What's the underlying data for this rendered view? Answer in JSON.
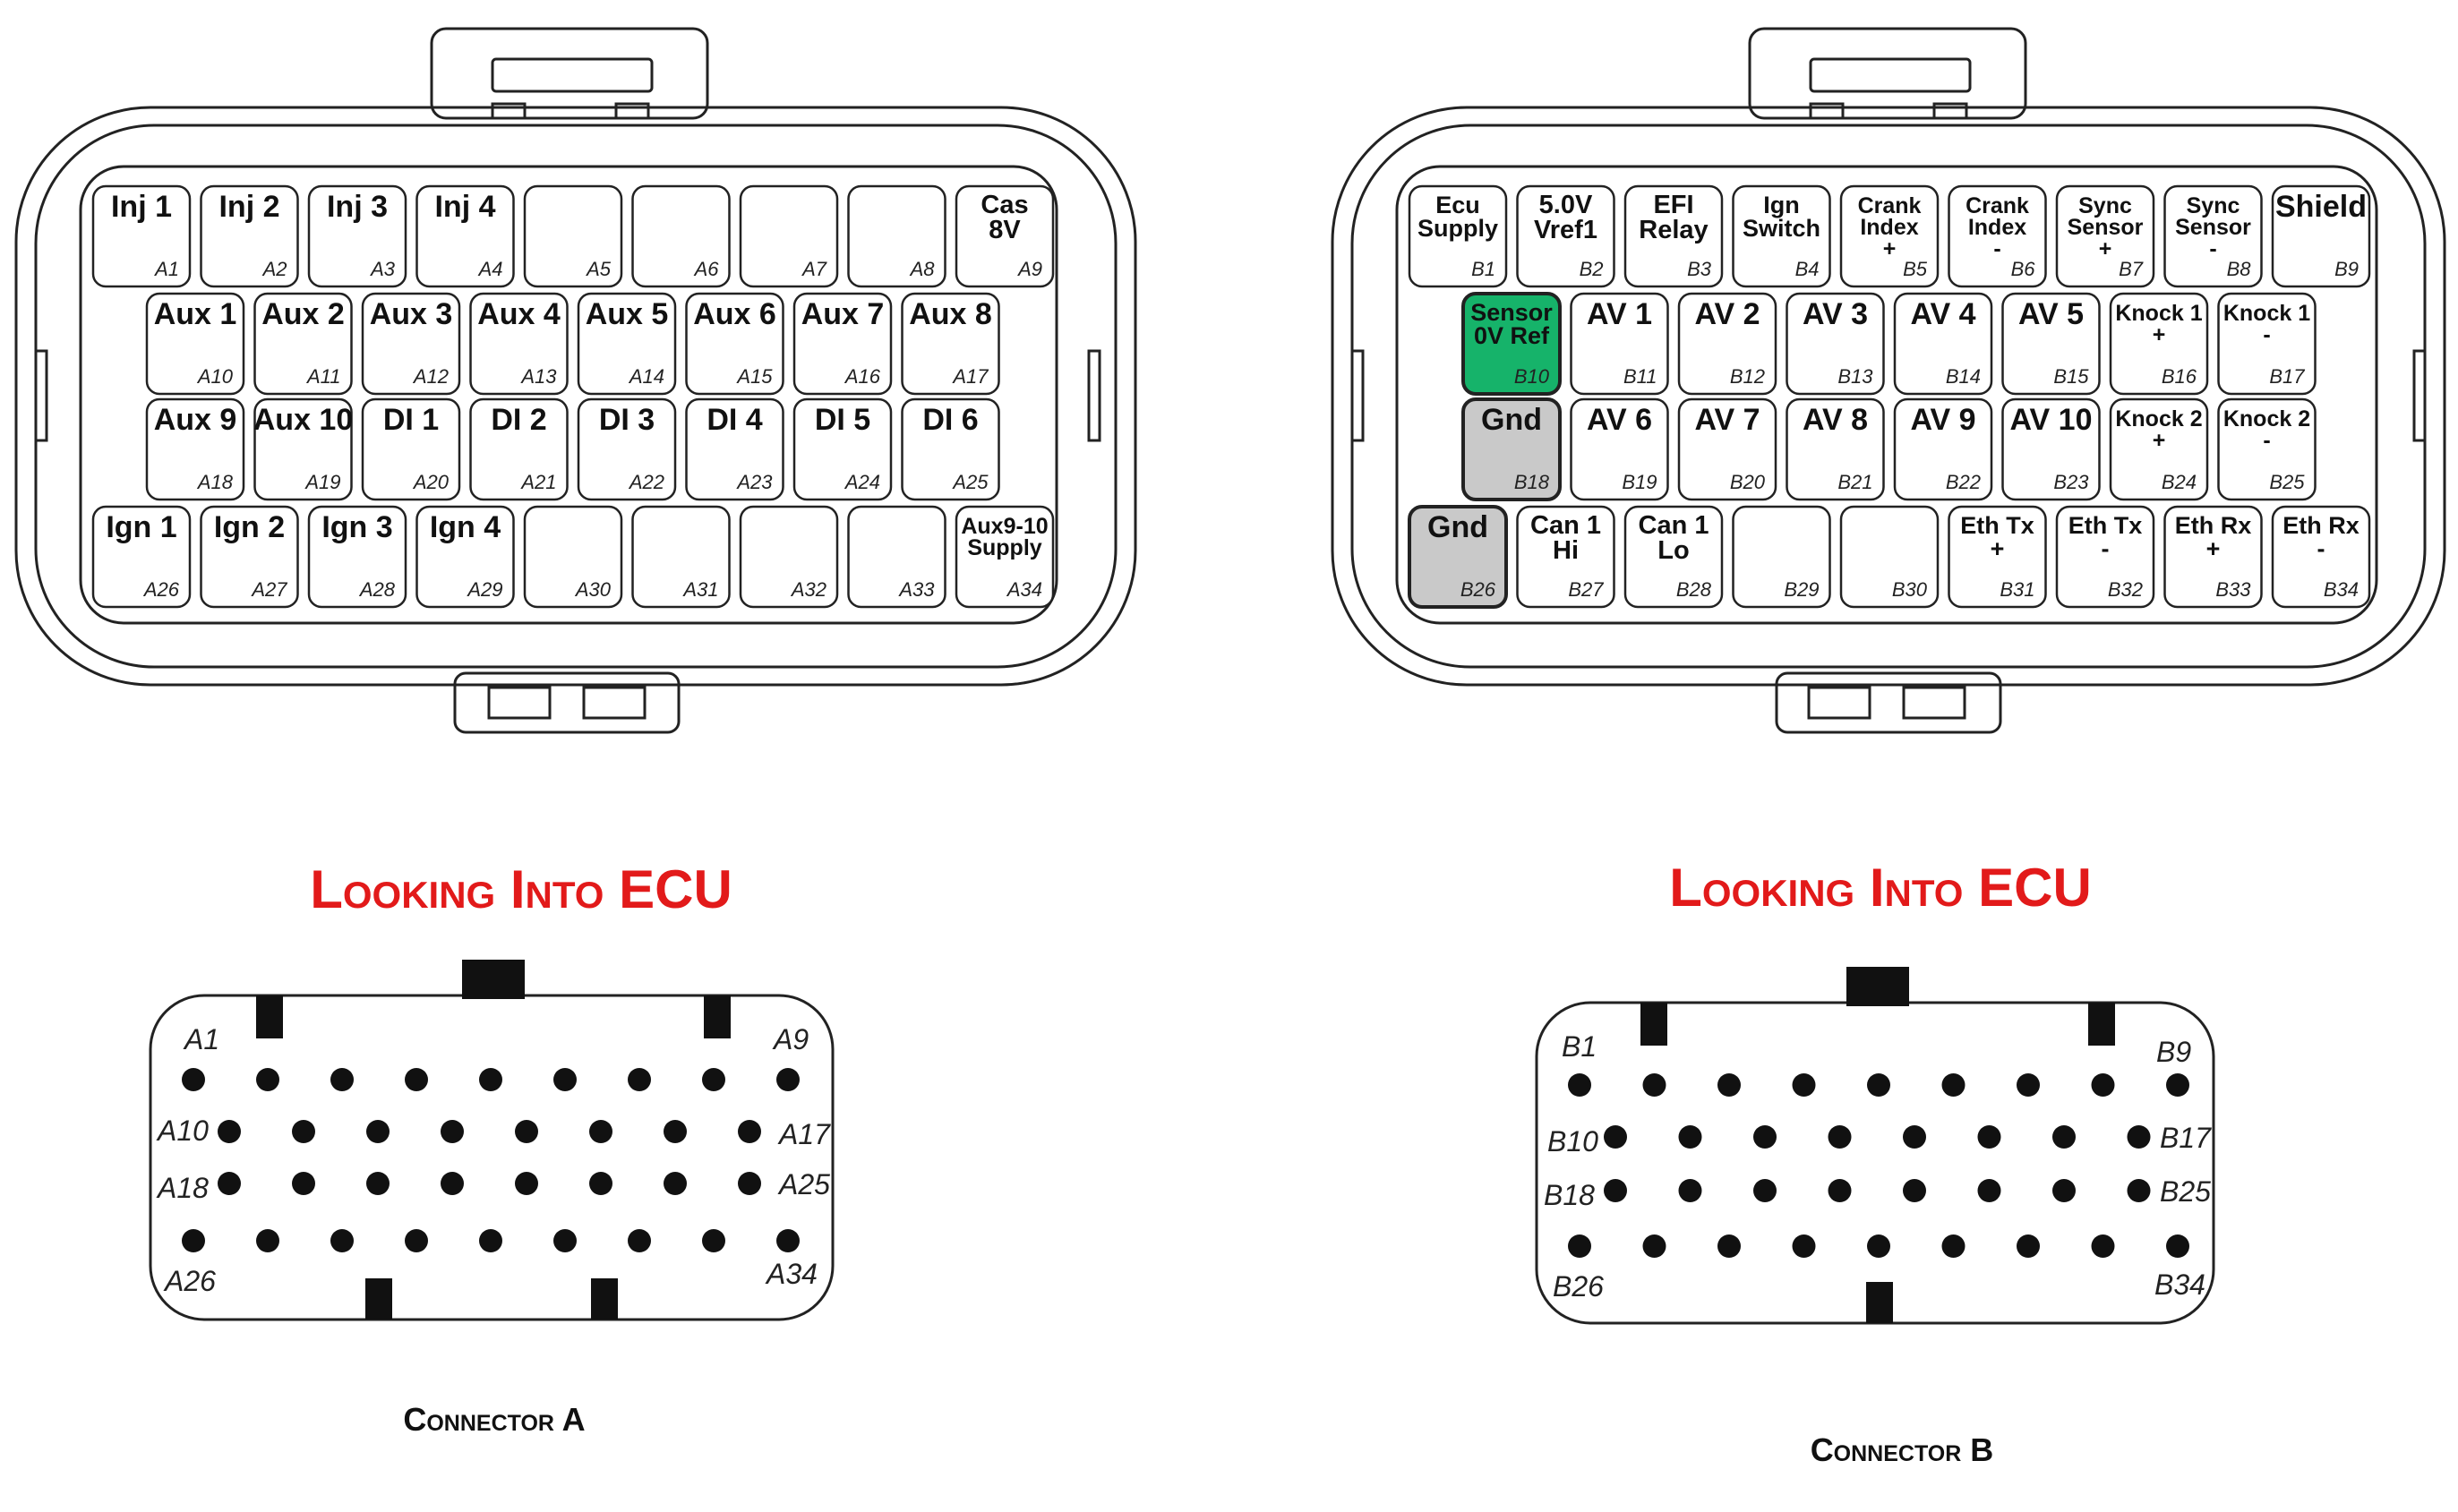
{
  "colors": {
    "heading": "#e21a1a",
    "highlight_green": "#16b36a",
    "highlight_gray": "#c9c9c9",
    "stroke": "#222222"
  },
  "connectors": [
    {
      "id": "A",
      "heading": "Looking Into ECU",
      "caption": "Connector A",
      "pins": [
        {
          "lines": [
            "Inj 1"
          ],
          "num": "A1"
        },
        {
          "lines": [
            "Inj 2"
          ],
          "num": "A2"
        },
        {
          "lines": [
            "Inj 3"
          ],
          "num": "A3"
        },
        {
          "lines": [
            "Inj 4"
          ],
          "num": "A4"
        },
        {
          "lines": [
            ""
          ],
          "num": "A5"
        },
        {
          "lines": [
            ""
          ],
          "num": "A6"
        },
        {
          "lines": [
            ""
          ],
          "num": "A7"
        },
        {
          "lines": [
            ""
          ],
          "num": "A8"
        },
        {
          "lines": [
            "Cas",
            "8V"
          ],
          "num": "A9"
        },
        {
          "lines": [
            "Aux 1"
          ],
          "num": "A10"
        },
        {
          "lines": [
            "Aux 2"
          ],
          "num": "A11"
        },
        {
          "lines": [
            "Aux 3"
          ],
          "num": "A12"
        },
        {
          "lines": [
            "Aux 4"
          ],
          "num": "A13"
        },
        {
          "lines": [
            "Aux 5"
          ],
          "num": "A14"
        },
        {
          "lines": [
            "Aux 6"
          ],
          "num": "A15"
        },
        {
          "lines": [
            "Aux 7"
          ],
          "num": "A16"
        },
        {
          "lines": [
            "Aux 8"
          ],
          "num": "A17"
        },
        {
          "lines": [
            "Aux 9"
          ],
          "num": "A18"
        },
        {
          "lines": [
            "Aux 10"
          ],
          "num": "A19"
        },
        {
          "lines": [
            "DI 1"
          ],
          "num": "A20"
        },
        {
          "lines": [
            "DI 2"
          ],
          "num": "A21"
        },
        {
          "lines": [
            "DI 3"
          ],
          "num": "A22"
        },
        {
          "lines": [
            "DI 4"
          ],
          "num": "A23"
        },
        {
          "lines": [
            "DI 5"
          ],
          "num": "A24"
        },
        {
          "lines": [
            "DI 6"
          ],
          "num": "A25"
        },
        {
          "lines": [
            "Ign 1"
          ],
          "num": "A26"
        },
        {
          "lines": [
            "Ign 2"
          ],
          "num": "A27"
        },
        {
          "lines": [
            "Ign 3"
          ],
          "num": "A28"
        },
        {
          "lines": [
            "Ign 4"
          ],
          "num": "A29"
        },
        {
          "lines": [
            ""
          ],
          "num": "A30"
        },
        {
          "lines": [
            ""
          ],
          "num": "A31"
        },
        {
          "lines": [
            ""
          ],
          "num": "A32"
        },
        {
          "lines": [
            ""
          ],
          "num": "A33"
        },
        {
          "lines": [
            "Aux9-10",
            "Supply"
          ],
          "num": "A34"
        }
      ],
      "face_labels": {
        "r1_left": "A1",
        "r1_right": "A9",
        "r2_left": "A10",
        "r2_right": "A17",
        "r3_left": "A18",
        "r3_right": "A25",
        "r4_left": "A26",
        "r4_right": "A34"
      }
    },
    {
      "id": "B",
      "heading": "Looking Into ECU",
      "caption": "Connector B",
      "pins": [
        {
          "lines": [
            "Ecu",
            "Supply"
          ],
          "num": "B1"
        },
        {
          "lines": [
            "5.0V",
            "Vref1"
          ],
          "num": "B2"
        },
        {
          "lines": [
            "EFI",
            "Relay"
          ],
          "num": "B3"
        },
        {
          "lines": [
            "Ign",
            "Switch"
          ],
          "num": "B4"
        },
        {
          "lines": [
            "Crank",
            "Index",
            "+"
          ],
          "num": "B5"
        },
        {
          "lines": [
            "Crank",
            "Index",
            "-"
          ],
          "num": "B6"
        },
        {
          "lines": [
            "Sync",
            "Sensor",
            "+"
          ],
          "num": "B7"
        },
        {
          "lines": [
            "Sync",
            "Sensor",
            "-"
          ],
          "num": "B8"
        },
        {
          "lines": [
            "Shield"
          ],
          "num": "B9"
        },
        {
          "lines": [
            "Sensor",
            "0V Ref"
          ],
          "num": "B10",
          "fill": "green"
        },
        {
          "lines": [
            "AV 1"
          ],
          "num": "B11"
        },
        {
          "lines": [
            "AV 2"
          ],
          "num": "B12"
        },
        {
          "lines": [
            "AV 3"
          ],
          "num": "B13"
        },
        {
          "lines": [
            "AV 4"
          ],
          "num": "B14"
        },
        {
          "lines": [
            "AV 5"
          ],
          "num": "B15"
        },
        {
          "lines": [
            "Knock 1",
            "+"
          ],
          "num": "B16"
        },
        {
          "lines": [
            "Knock 1",
            "-"
          ],
          "num": "B17"
        },
        {
          "lines": [
            "Gnd"
          ],
          "num": "B18",
          "fill": "gray"
        },
        {
          "lines": [
            "AV 6"
          ],
          "num": "B19"
        },
        {
          "lines": [
            "AV 7"
          ],
          "num": "B20"
        },
        {
          "lines": [
            "AV 8"
          ],
          "num": "B21"
        },
        {
          "lines": [
            "AV 9"
          ],
          "num": "B22"
        },
        {
          "lines": [
            "AV 10"
          ],
          "num": "B23"
        },
        {
          "lines": [
            "Knock 2",
            "+"
          ],
          "num": "B24"
        },
        {
          "lines": [
            "Knock 2",
            "-"
          ],
          "num": "B25"
        },
        {
          "lines": [
            "Gnd"
          ],
          "num": "B26",
          "fill": "gray"
        },
        {
          "lines": [
            "Can 1",
            "Hi"
          ],
          "num": "B27"
        },
        {
          "lines": [
            "Can 1",
            "Lo"
          ],
          "num": "B28"
        },
        {
          "lines": [
            ""
          ],
          "num": "B29"
        },
        {
          "lines": [
            ""
          ],
          "num": "B30"
        },
        {
          "lines": [
            "Eth Tx",
            "+"
          ],
          "num": "B31"
        },
        {
          "lines": [
            "Eth Tx",
            "-"
          ],
          "num": "B32"
        },
        {
          "lines": [
            "Eth Rx",
            "+"
          ],
          "num": "B33"
        },
        {
          "lines": [
            "Eth Rx",
            "-"
          ],
          "num": "B34"
        }
      ],
      "face_labels": {
        "r1_left": "B1",
        "r1_right": "B9",
        "r2_left": "B10",
        "r2_right": "B17",
        "r3_left": "B18",
        "r3_right": "B25",
        "r4_left": "B26",
        "r4_right": "B34"
      }
    }
  ]
}
